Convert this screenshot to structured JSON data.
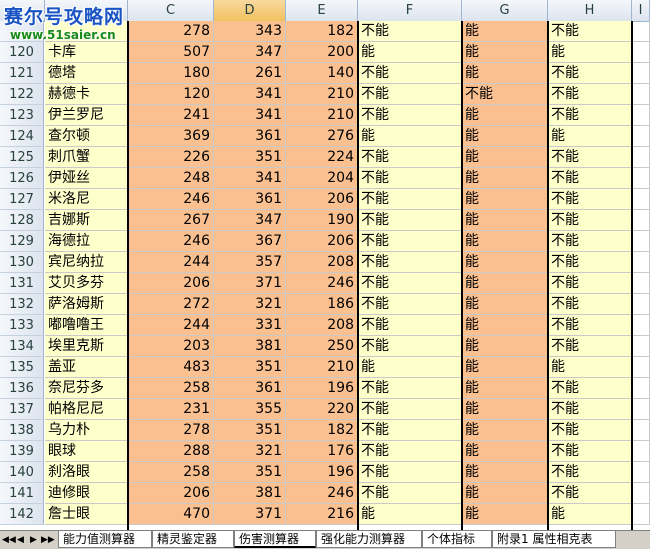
{
  "watermark": {
    "line1": "赛尔号攻略网",
    "line2": "www.51saier.cn"
  },
  "columns": [
    {
      "id": "C",
      "label": "C"
    },
    {
      "id": "D",
      "label": "D"
    },
    {
      "id": "E",
      "label": "E"
    },
    {
      "id": "F",
      "label": "F"
    },
    {
      "id": "G",
      "label": "G"
    },
    {
      "id": "H",
      "label": "H"
    },
    {
      "id": "I",
      "label": "I"
    }
  ],
  "rows": [
    {
      "num": "",
      "name": "",
      "c": "278",
      "d": "343",
      "e": "182",
      "f": "不能",
      "g": "能",
      "h": "不能"
    },
    {
      "num": "120",
      "name": "卡库",
      "c": "507",
      "d": "347",
      "e": "200",
      "f": "能",
      "g": "能",
      "h": "能"
    },
    {
      "num": "121",
      "name": "德塔",
      "c": "180",
      "d": "261",
      "e": "140",
      "f": "不能",
      "g": "能",
      "h": "不能"
    },
    {
      "num": "122",
      "name": "赫德卡",
      "c": "120",
      "d": "341",
      "e": "210",
      "f": "不能",
      "g": "不能",
      "h": "不能"
    },
    {
      "num": "123",
      "name": "伊兰罗尼",
      "c": "241",
      "d": "341",
      "e": "210",
      "f": "不能",
      "g": "能",
      "h": "不能"
    },
    {
      "num": "124",
      "name": "查尔顿",
      "c": "369",
      "d": "361",
      "e": "276",
      "f": "能",
      "g": "能",
      "h": "能"
    },
    {
      "num": "125",
      "name": "刺爪蟹",
      "c": "226",
      "d": "351",
      "e": "224",
      "f": "不能",
      "g": "能",
      "h": "不能"
    },
    {
      "num": "126",
      "name": "伊娅丝",
      "c": "248",
      "d": "341",
      "e": "204",
      "f": "不能",
      "g": "能",
      "h": "不能"
    },
    {
      "num": "127",
      "name": "米洛尼",
      "c": "246",
      "d": "361",
      "e": "206",
      "f": "不能",
      "g": "能",
      "h": "不能"
    },
    {
      "num": "128",
      "name": "吉娜斯",
      "c": "267",
      "d": "347",
      "e": "190",
      "f": "不能",
      "g": "能",
      "h": "不能"
    },
    {
      "num": "129",
      "name": "海德拉",
      "c": "246",
      "d": "367",
      "e": "206",
      "f": "不能",
      "g": "能",
      "h": "不能"
    },
    {
      "num": "130",
      "name": "宾尼纳拉",
      "c": "244",
      "d": "357",
      "e": "208",
      "f": "不能",
      "g": "能",
      "h": "不能"
    },
    {
      "num": "131",
      "name": "艾贝多芬",
      "c": "206",
      "d": "371",
      "e": "246",
      "f": "不能",
      "g": "能",
      "h": "不能"
    },
    {
      "num": "132",
      "name": "萨洛姆斯",
      "c": "272",
      "d": "321",
      "e": "186",
      "f": "不能",
      "g": "能",
      "h": "不能"
    },
    {
      "num": "133",
      "name": "嘟噜噜王",
      "c": "244",
      "d": "331",
      "e": "208",
      "f": "不能",
      "g": "能",
      "h": "不能"
    },
    {
      "num": "134",
      "name": "埃里克斯",
      "c": "203",
      "d": "381",
      "e": "250",
      "f": "不能",
      "g": "能",
      "h": "不能"
    },
    {
      "num": "135",
      "name": "盖亚",
      "c": "483",
      "d": "351",
      "e": "210",
      "f": "能",
      "g": "能",
      "h": "能"
    },
    {
      "num": "136",
      "name": "奈尼芬多",
      "c": "258",
      "d": "361",
      "e": "196",
      "f": "不能",
      "g": "能",
      "h": "不能"
    },
    {
      "num": "137",
      "name": "帕格尼尼",
      "c": "231",
      "d": "355",
      "e": "220",
      "f": "不能",
      "g": "能",
      "h": "不能"
    },
    {
      "num": "138",
      "name": "乌力朴",
      "c": "278",
      "d": "351",
      "e": "182",
      "f": "不能",
      "g": "能",
      "h": "不能"
    },
    {
      "num": "139",
      "name": "眼球",
      "c": "288",
      "d": "321",
      "e": "176",
      "f": "不能",
      "g": "能",
      "h": "不能"
    },
    {
      "num": "140",
      "name": "刹洛眼",
      "c": "258",
      "d": "351",
      "e": "196",
      "f": "不能",
      "g": "能",
      "h": "不能"
    },
    {
      "num": "141",
      "name": "迪修眼",
      "c": "206",
      "d": "381",
      "e": "246",
      "f": "不能",
      "g": "能",
      "h": "不能"
    },
    {
      "num": "142",
      "name": "詹士眼",
      "c": "470",
      "d": "371",
      "e": "216",
      "f": "能",
      "g": "能",
      "h": "能"
    }
  ],
  "tabs": [
    {
      "label": "能力值测算器",
      "active": false
    },
    {
      "label": "精灵鉴定器",
      "active": false
    },
    {
      "label": "伤害测算器",
      "active": true
    },
    {
      "label": "强化能力测算器",
      "active": false
    },
    {
      "label": "个体指标",
      "active": false
    },
    {
      "label": "附录1 属性相克表",
      "active": false
    }
  ],
  "nav": [
    "◀◀",
    "◀",
    "▶",
    "▶▶"
  ]
}
